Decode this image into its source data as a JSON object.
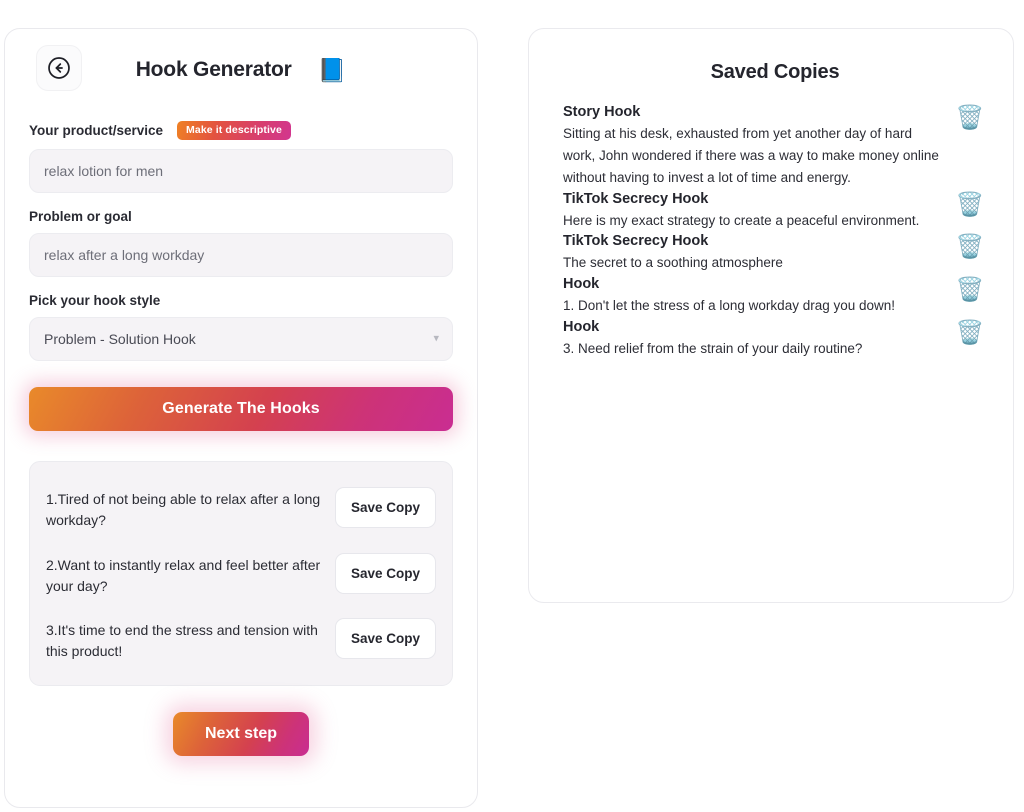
{
  "left_panel": {
    "back_icon": "arrow-left-circle-icon",
    "title": "Hook Generator",
    "notebook_icon": "📘",
    "fields": {
      "product": {
        "label": "Your product/service",
        "badge": "Make it descriptive",
        "value": "relax lotion for men",
        "placeholder": "relax lotion for men"
      },
      "problem": {
        "label": "Problem or goal",
        "value": "relax after a long workday",
        "placeholder": "relax after a long workday"
      },
      "style": {
        "label": "Pick your hook style",
        "value": "Problem - Solution Hook",
        "options": [
          "Problem - Solution Hook"
        ],
        "caret_icon": "chevron-down-icon"
      }
    },
    "generate_label": "Generate The Hooks",
    "save_copy_label": "Save Copy",
    "results": [
      "1.Tired of not being able to relax after a long workday?",
      "2.Want to instantly relax and feel better after your day?",
      "3.It's time to end the stress and tension with this product!"
    ],
    "next_label": "Next step"
  },
  "right_panel": {
    "title": "Saved Copies",
    "trash_icon": "🗑️",
    "items": [
      {
        "heading": "Story Hook",
        "text": "Sitting at his desk, exhausted from yet another day of hard work, John wondered if there was a way to make money online without having to invest a lot of time and energy."
      },
      {
        "heading": "TikTok Secrecy Hook",
        "text": "Here is my exact strategy to create a peaceful environment."
      },
      {
        "heading": "TikTok Secrecy Hook",
        "text": "The secret to a soothing atmosphere"
      },
      {
        "heading": "Hook",
        "text": "1. Don't let the stress of a long workday drag you down!"
      },
      {
        "heading": "Hook",
        "text": "3. Need relief from the strain of your daily routine?"
      }
    ]
  },
  "colors": {
    "gradient_start": "#e98a2a",
    "gradient_mid": "#d4414f",
    "gradient_end": "#c92d92",
    "panel_bg": "#ffffff",
    "input_bg": "#f5f3f6",
    "text": "#24252d"
  }
}
